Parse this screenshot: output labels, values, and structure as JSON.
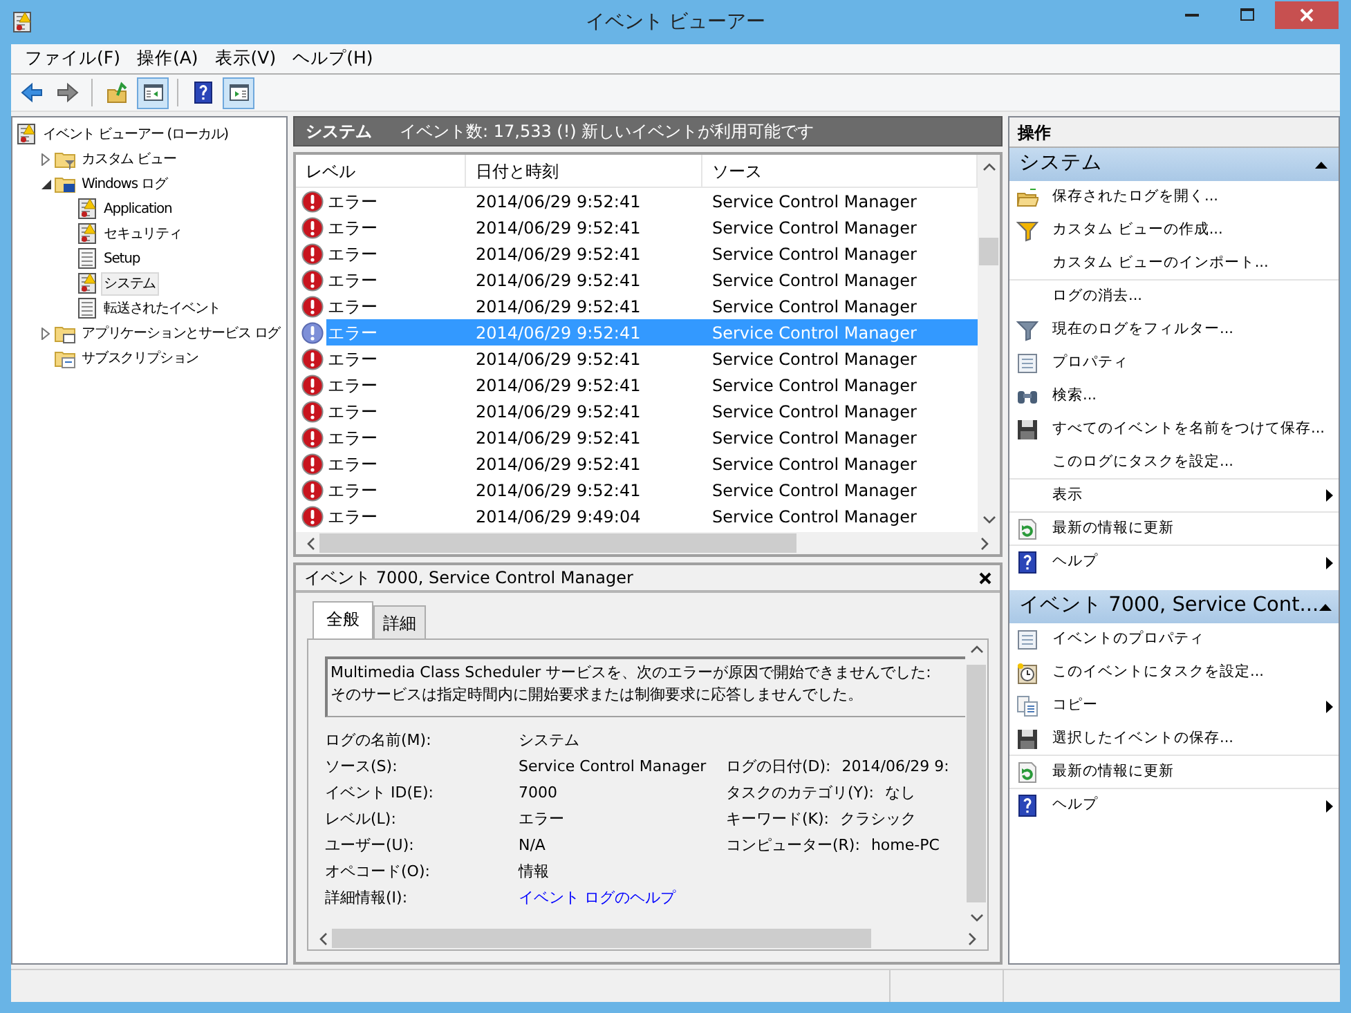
{
  "window": {
    "title": "イベント ビューアー"
  },
  "menu": [
    "ファイル(F)",
    "操作(A)",
    "表示(V)",
    "ヘルプ(H)"
  ],
  "toolbar": [
    {
      "kind": "back",
      "pressed": false
    },
    {
      "kind": "forward",
      "pressed": false
    },
    {
      "kind": "sep"
    },
    {
      "kind": "up",
      "pressed": false
    },
    {
      "kind": "tree",
      "pressed": true
    },
    {
      "kind": "sep"
    },
    {
      "kind": "help",
      "pressed": false
    },
    {
      "kind": "actions",
      "pressed": true
    }
  ],
  "tree": [
    {
      "label": "イベント ビューアー (ローカル)",
      "selected": false,
      "children": [
        {
          "label": "カスタム ビュー",
          "expanded": false,
          "selected": false
        },
        {
          "label": "Windows ログ",
          "expanded": true,
          "selected": false,
          "children": [
            {
              "label": "Application",
              "selected": false
            },
            {
              "label": "セキュリティ",
              "selected": false
            },
            {
              "label": "Setup",
              "selected": false
            },
            {
              "label": "システム",
              "selected": true
            },
            {
              "label": "転送されたイベント",
              "selected": false
            }
          ]
        },
        {
          "label": "アプリケーションとサービス ログ",
          "expanded": false,
          "selected": false
        },
        {
          "label": "サブスクリプション",
          "selected": false
        }
      ]
    }
  ],
  "header": {
    "title": "システム",
    "summary": "イベント数: 17,533 (!) 新しいイベントが利用可能です"
  },
  "table": {
    "columns": [
      "レベル",
      "日付と時刻",
      "ソース"
    ],
    "rows": [
      {
        "level": "エラー",
        "date": "2014/06/29 9:52:41",
        "source": "Service Control Manager",
        "selected": false
      },
      {
        "level": "エラー",
        "date": "2014/06/29 9:52:41",
        "source": "Service Control Manager",
        "selected": false
      },
      {
        "level": "エラー",
        "date": "2014/06/29 9:52:41",
        "source": "Service Control Manager",
        "selected": false
      },
      {
        "level": "エラー",
        "date": "2014/06/29 9:52:41",
        "source": "Service Control Manager",
        "selected": false
      },
      {
        "level": "エラー",
        "date": "2014/06/29 9:52:41",
        "source": "Service Control Manager",
        "selected": false
      },
      {
        "level": "エラー",
        "date": "2014/06/29 9:52:41",
        "source": "Service Control Manager",
        "selected": true
      },
      {
        "level": "エラー",
        "date": "2014/06/29 9:52:41",
        "source": "Service Control Manager",
        "selected": false
      },
      {
        "level": "エラー",
        "date": "2014/06/29 9:52:41",
        "source": "Service Control Manager",
        "selected": false
      },
      {
        "level": "エラー",
        "date": "2014/06/29 9:52:41",
        "source": "Service Control Manager",
        "selected": false
      },
      {
        "level": "エラー",
        "date": "2014/06/29 9:52:41",
        "source": "Service Control Manager",
        "selected": false
      },
      {
        "level": "エラー",
        "date": "2014/06/29 9:52:41",
        "source": "Service Control Manager",
        "selected": false
      },
      {
        "level": "エラー",
        "date": "2014/06/29 9:52:41",
        "source": "Service Control Manager",
        "selected": false
      },
      {
        "level": "エラー",
        "date": "2014/06/29 9:49:04",
        "source": "Service Control Manager",
        "selected": false
      }
    ]
  },
  "detail": {
    "title": "イベント 7000, Service Control Manager",
    "tabs": [
      {
        "label": "全般",
        "selected": true
      },
      {
        "label": "詳細",
        "selected": false
      }
    ],
    "message": [
      "Multimedia Class Scheduler サービスを、次のエラーが原因で開始できませんでした:",
      "そのサービスは指定時間内に開始要求または制御要求に応答しませんでした。"
    ],
    "rows": [
      [
        {
          "label": "ログの名前(M):",
          "value": "システム",
          "kind": "text"
        }
      ],
      [
        {
          "label": "ソース(S):",
          "value": "Service Control Manager",
          "kind": "text"
        },
        {
          "label": "ログの日付(D):",
          "value": "2014/06/29 9:",
          "kind": "text"
        }
      ],
      [
        {
          "label": "イベント ID(E):",
          "value": "7000",
          "kind": "text"
        },
        {
          "label": "タスクのカテゴリ(Y):",
          "value": "なし",
          "kind": "text"
        }
      ],
      [
        {
          "label": "レベル(L):",
          "value": "エラー",
          "kind": "text"
        },
        {
          "label": "キーワード(K):",
          "value": "クラシック",
          "kind": "text"
        }
      ],
      [
        {
          "label": "ユーザー(U):",
          "value": "N/A",
          "kind": "text"
        },
        {
          "label": "コンピューター(R):",
          "value": "home-PC",
          "kind": "text"
        }
      ],
      [
        {
          "label": "オペコード(O):",
          "value": "情報",
          "kind": "text"
        }
      ],
      [
        {
          "label": "詳細情報(I):",
          "value": "イベント ログのヘルプ",
          "kind": "link"
        }
      ]
    ]
  },
  "actions": {
    "title": "操作",
    "sections": [
      {
        "title": "システム",
        "expanded": true,
        "items": [
          {
            "label": "保存されたログを開く...",
            "submenu": false,
            "divider_after": false
          },
          {
            "label": "カスタム ビューの作成...",
            "submenu": false,
            "divider_after": false
          },
          {
            "label": "カスタム ビューのインポート...",
            "submenu": false,
            "divider_after": true
          },
          {
            "label": "ログの消去...",
            "submenu": false,
            "divider_after": false
          },
          {
            "label": "現在のログをフィルター...",
            "submenu": false,
            "divider_after": false
          },
          {
            "label": "プロパティ",
            "submenu": false,
            "divider_after": false
          },
          {
            "label": "検索...",
            "submenu": false,
            "divider_after": false
          },
          {
            "label": "すべてのイベントを名前をつけて保存...",
            "submenu": false,
            "divider_after": false
          },
          {
            "label": "このログにタスクを設定...",
            "submenu": false,
            "divider_after": true
          },
          {
            "label": "表示",
            "submenu": true,
            "divider_after": true
          },
          {
            "label": "最新の情報に更新",
            "submenu": false,
            "divider_after": true
          },
          {
            "label": "ヘルプ",
            "submenu": true,
            "divider_after": false
          }
        ]
      },
      {
        "title": "イベント 7000, Service Cont...",
        "expanded": true,
        "items": [
          {
            "label": "イベントのプロパティ",
            "submenu": false,
            "divider_after": false
          },
          {
            "label": "このイベントにタスクを設定...",
            "submenu": false,
            "divider_after": false
          },
          {
            "label": "コピー",
            "submenu": true,
            "divider_after": false
          },
          {
            "label": "選択したイベントの保存...",
            "submenu": false,
            "divider_after": true
          },
          {
            "label": "最新の情報に更新",
            "submenu": false,
            "divider_after": true
          },
          {
            "label": "ヘルプ",
            "submenu": true,
            "divider_after": false
          }
        ]
      }
    ]
  }
}
